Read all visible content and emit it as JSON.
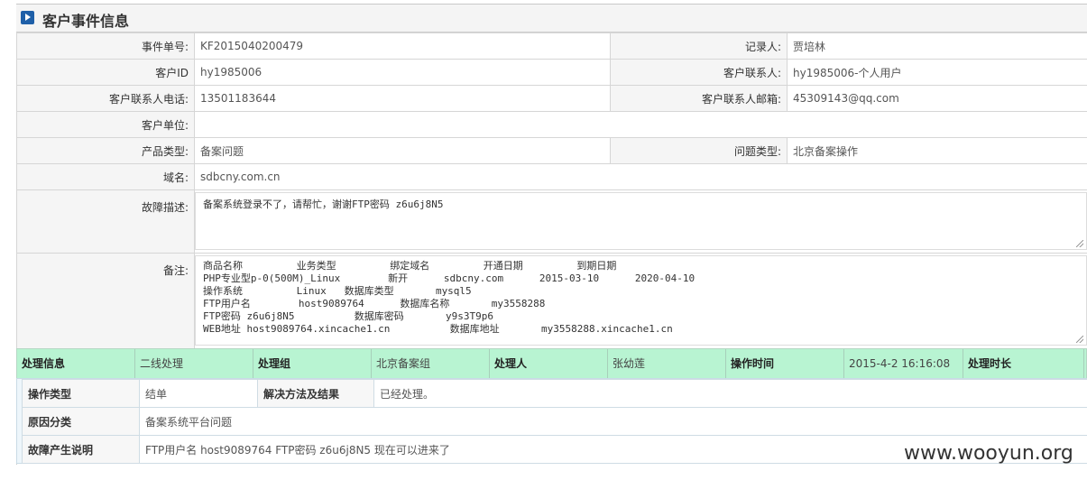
{
  "panel": {
    "title": "客户事件信息"
  },
  "fields": {
    "event_no_label": "事件单号:",
    "event_no": "KF2015040200479",
    "recorder_label": "记录人:",
    "recorder": "贾培林",
    "cust_id_label": "客户ID",
    "cust_id": "hy1985006",
    "contact_label": "客户联系人:",
    "contact": "hy1985006-个人用户",
    "phone_label": "客户联系人电话:",
    "phone": "13501183644",
    "email_label": "客户联系人邮箱:",
    "email": "45309143@qq.com",
    "unit_label": "客户单位:",
    "unit": "",
    "product_type_label": "产品类型:",
    "product_type": "备案问题",
    "issue_type_label": "问题类型:",
    "issue_type": "北京备案操作",
    "domain_label": "域名:",
    "domain": "sdbcny.com.cn",
    "fault_label": "故障描述:",
    "fault": "备案系统登录不了，请帮忙，谢谢FTP密码    z6u6j8N5",
    "remark_label": "备注:",
    "remark_lines": [
      "商品名称         业务类型         绑定域名         开通日期         到期日期",
      "PHP专业型p-0(500M)_Linux        新开      sdbcny.com      2015-03-10      2020-04-10",
      "操作系统         Linux   数据库类型       mysql5",
      "FTP用户名        host9089764      数据库名称       my3558288",
      "FTP密码 z6u6j8N5          数据库密码       y9s3T9p6",
      "WEB地址 host9089764.xincache1.cn          数据库地址       my3558288.xincache1.cn"
    ]
  },
  "processing": {
    "info_label": "处理信息",
    "info": "二线处理",
    "group_label": "处理组",
    "group": "北京备案组",
    "handler_label": "处理人",
    "handler": "张幼莲",
    "time_label": "操作时间",
    "time": "2015-4-2 16:16:08",
    "duration_label": "处理时长"
  },
  "detail": {
    "op_type_label": "操作类型",
    "op_type": "结单",
    "solution_label": "解决方法及结果",
    "solution": "已经处理。",
    "reason_label": "原因分类",
    "reason": "备案系统平台问题",
    "cause_label": "故障产生说明",
    "cause": "FTP用户名 host9089764 FTP密码 z6u6j8N5 现在可以进来了"
  },
  "watermark": "www.wooyun.org"
}
